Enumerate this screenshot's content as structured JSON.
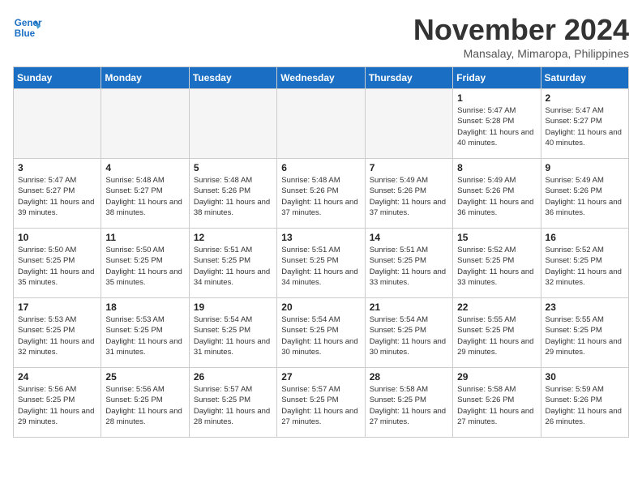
{
  "header": {
    "logo_line1": "General",
    "logo_line2": "Blue",
    "month_title": "November 2024",
    "location": "Mansalay, Mimaropa, Philippines"
  },
  "days_of_week": [
    "Sunday",
    "Monday",
    "Tuesday",
    "Wednesday",
    "Thursday",
    "Friday",
    "Saturday"
  ],
  "weeks": [
    [
      {
        "day": "",
        "info": "",
        "empty": true
      },
      {
        "day": "",
        "info": "",
        "empty": true
      },
      {
        "day": "",
        "info": "",
        "empty": true
      },
      {
        "day": "",
        "info": "",
        "empty": true
      },
      {
        "day": "",
        "info": "",
        "empty": true
      },
      {
        "day": "1",
        "info": "Sunrise: 5:47 AM\nSunset: 5:28 PM\nDaylight: 11 hours and 40 minutes.",
        "empty": false
      },
      {
        "day": "2",
        "info": "Sunrise: 5:47 AM\nSunset: 5:27 PM\nDaylight: 11 hours and 40 minutes.",
        "empty": false
      }
    ],
    [
      {
        "day": "3",
        "info": "Sunrise: 5:47 AM\nSunset: 5:27 PM\nDaylight: 11 hours and 39 minutes.",
        "empty": false
      },
      {
        "day": "4",
        "info": "Sunrise: 5:48 AM\nSunset: 5:27 PM\nDaylight: 11 hours and 38 minutes.",
        "empty": false
      },
      {
        "day": "5",
        "info": "Sunrise: 5:48 AM\nSunset: 5:26 PM\nDaylight: 11 hours and 38 minutes.",
        "empty": false
      },
      {
        "day": "6",
        "info": "Sunrise: 5:48 AM\nSunset: 5:26 PM\nDaylight: 11 hours and 37 minutes.",
        "empty": false
      },
      {
        "day": "7",
        "info": "Sunrise: 5:49 AM\nSunset: 5:26 PM\nDaylight: 11 hours and 37 minutes.",
        "empty": false
      },
      {
        "day": "8",
        "info": "Sunrise: 5:49 AM\nSunset: 5:26 PM\nDaylight: 11 hours and 36 minutes.",
        "empty": false
      },
      {
        "day": "9",
        "info": "Sunrise: 5:49 AM\nSunset: 5:26 PM\nDaylight: 11 hours and 36 minutes.",
        "empty": false
      }
    ],
    [
      {
        "day": "10",
        "info": "Sunrise: 5:50 AM\nSunset: 5:25 PM\nDaylight: 11 hours and 35 minutes.",
        "empty": false
      },
      {
        "day": "11",
        "info": "Sunrise: 5:50 AM\nSunset: 5:25 PM\nDaylight: 11 hours and 35 minutes.",
        "empty": false
      },
      {
        "day": "12",
        "info": "Sunrise: 5:51 AM\nSunset: 5:25 PM\nDaylight: 11 hours and 34 minutes.",
        "empty": false
      },
      {
        "day": "13",
        "info": "Sunrise: 5:51 AM\nSunset: 5:25 PM\nDaylight: 11 hours and 34 minutes.",
        "empty": false
      },
      {
        "day": "14",
        "info": "Sunrise: 5:51 AM\nSunset: 5:25 PM\nDaylight: 11 hours and 33 minutes.",
        "empty": false
      },
      {
        "day": "15",
        "info": "Sunrise: 5:52 AM\nSunset: 5:25 PM\nDaylight: 11 hours and 33 minutes.",
        "empty": false
      },
      {
        "day": "16",
        "info": "Sunrise: 5:52 AM\nSunset: 5:25 PM\nDaylight: 11 hours and 32 minutes.",
        "empty": false
      }
    ],
    [
      {
        "day": "17",
        "info": "Sunrise: 5:53 AM\nSunset: 5:25 PM\nDaylight: 11 hours and 32 minutes.",
        "empty": false
      },
      {
        "day": "18",
        "info": "Sunrise: 5:53 AM\nSunset: 5:25 PM\nDaylight: 11 hours and 31 minutes.",
        "empty": false
      },
      {
        "day": "19",
        "info": "Sunrise: 5:54 AM\nSunset: 5:25 PM\nDaylight: 11 hours and 31 minutes.",
        "empty": false
      },
      {
        "day": "20",
        "info": "Sunrise: 5:54 AM\nSunset: 5:25 PM\nDaylight: 11 hours and 30 minutes.",
        "empty": false
      },
      {
        "day": "21",
        "info": "Sunrise: 5:54 AM\nSunset: 5:25 PM\nDaylight: 11 hours and 30 minutes.",
        "empty": false
      },
      {
        "day": "22",
        "info": "Sunrise: 5:55 AM\nSunset: 5:25 PM\nDaylight: 11 hours and 29 minutes.",
        "empty": false
      },
      {
        "day": "23",
        "info": "Sunrise: 5:55 AM\nSunset: 5:25 PM\nDaylight: 11 hours and 29 minutes.",
        "empty": false
      }
    ],
    [
      {
        "day": "24",
        "info": "Sunrise: 5:56 AM\nSunset: 5:25 PM\nDaylight: 11 hours and 29 minutes.",
        "empty": false
      },
      {
        "day": "25",
        "info": "Sunrise: 5:56 AM\nSunset: 5:25 PM\nDaylight: 11 hours and 28 minutes.",
        "empty": false
      },
      {
        "day": "26",
        "info": "Sunrise: 5:57 AM\nSunset: 5:25 PM\nDaylight: 11 hours and 28 minutes.",
        "empty": false
      },
      {
        "day": "27",
        "info": "Sunrise: 5:57 AM\nSunset: 5:25 PM\nDaylight: 11 hours and 27 minutes.",
        "empty": false
      },
      {
        "day": "28",
        "info": "Sunrise: 5:58 AM\nSunset: 5:25 PM\nDaylight: 11 hours and 27 minutes.",
        "empty": false
      },
      {
        "day": "29",
        "info": "Sunrise: 5:58 AM\nSunset: 5:26 PM\nDaylight: 11 hours and 27 minutes.",
        "empty": false
      },
      {
        "day": "30",
        "info": "Sunrise: 5:59 AM\nSunset: 5:26 PM\nDaylight: 11 hours and 26 minutes.",
        "empty": false
      }
    ]
  ]
}
